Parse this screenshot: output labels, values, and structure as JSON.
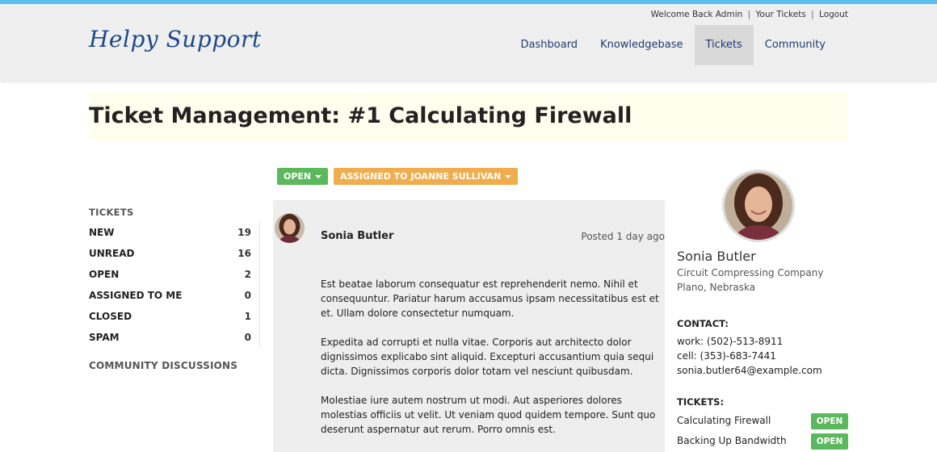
{
  "header": {
    "welcome": "Welcome Back Admin",
    "your_tickets": "Your Tickets",
    "logout": "Logout",
    "separator": "|",
    "logo": "Helpy Support",
    "nav": [
      {
        "label": "Dashboard",
        "active": false
      },
      {
        "label": "Knowledgebase",
        "active": false
      },
      {
        "label": "Tickets",
        "active": true
      },
      {
        "label": "Community",
        "active": false
      }
    ]
  },
  "page": {
    "title": "Ticket Management: #1 Calculating Firewall"
  },
  "ticket": {
    "status_label": "OPEN",
    "assign_label": "ASSIGNED TO JOANNE SULLIVAN",
    "status_color": "#5cb85c",
    "assign_color": "#f0ad4e"
  },
  "sidebar": {
    "heading": "TICKETS",
    "items": [
      {
        "label": "NEW",
        "count": "19"
      },
      {
        "label": "UNREAD",
        "count": "16"
      },
      {
        "label": "OPEN",
        "count": "2"
      },
      {
        "label": "ASSIGNED TO ME",
        "count": "0"
      },
      {
        "label": "CLOSED",
        "count": "1"
      },
      {
        "label": "SPAM",
        "count": "0"
      }
    ],
    "community_heading": "COMMUNITY DISCUSSIONS"
  },
  "post": {
    "author": "Sonia Butler",
    "posted": "Posted 1 day ago",
    "paragraphs": [
      "Est beatae laborum consequatur est reprehenderit nemo. Nihil et consequuntur. Pariatur harum accusamus ipsam necessitatibus est et et. Ullam dolore consectetur numquam.",
      "Expedita ad corrupti et nulla vitae. Corporis aut architecto dolor dignissimos explicabo sint aliquid. Excepturi accusantium quia sequi dicta. Dignissimos corporis dolor totam vel nesciunt quibusdam.",
      "Molestiae iure autem nostrum ut modi. Aut asperiores dolores molestias officiis ut velit. Ut veniam quod quidem tempore. Sunt quo deserunt aspernatur aut rerum. Porro omnis est."
    ]
  },
  "profile": {
    "name": "Sonia Butler",
    "company": "Circuit Compressing Company",
    "location": "Plano, Nebraska",
    "contact_heading": "CONTACT:",
    "work": "work: (502)-513-8911",
    "cell": "cell: (353)-683-7441",
    "email": "sonia.butler64@example.com",
    "tickets_heading": "TICKETS:",
    "tickets": [
      {
        "title": "Calculating Firewall",
        "status": "OPEN"
      },
      {
        "title": "Backing Up Bandwidth",
        "status": "OPEN"
      }
    ]
  },
  "colors": {
    "accent_bar": "#5bc0eb",
    "logo": "#1d4a8a",
    "title_band": "#ffffee"
  }
}
